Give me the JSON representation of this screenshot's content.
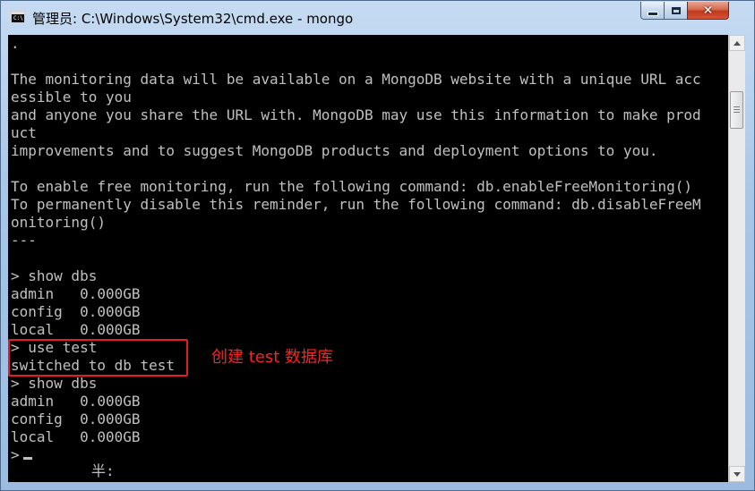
{
  "window": {
    "title": "管理员: C:\\Windows\\System32\\cmd.exe - mongo",
    "icon_label": "C:\\",
    "close_glyph": "✕"
  },
  "console": {
    "lines": [
      ".",
      "",
      "The monitoring data will be available on a MongoDB website with a unique URL acc",
      "essible to you",
      "and anyone you share the URL with. MongoDB may use this information to make prod",
      "uct",
      "improvements and to suggest MongoDB products and deployment options to you.",
      "",
      "To enable free monitoring, run the following command: db.enableFreeMonitoring()",
      "To permanently disable this reminder, run the following command: db.disableFreeM",
      "onitoring()",
      "---",
      "",
      "> show dbs",
      "admin   0.000GB",
      "config  0.000GB",
      "local   0.000GB",
      "> use test",
      "switched to db test",
      "> show dbs",
      "admin   0.000GB",
      "config  0.000GB",
      "local   0.000GB",
      ">"
    ],
    "ime_text": "半:"
  },
  "annotation": {
    "text": "创建 test 数据库",
    "color": "#ff2020"
  }
}
